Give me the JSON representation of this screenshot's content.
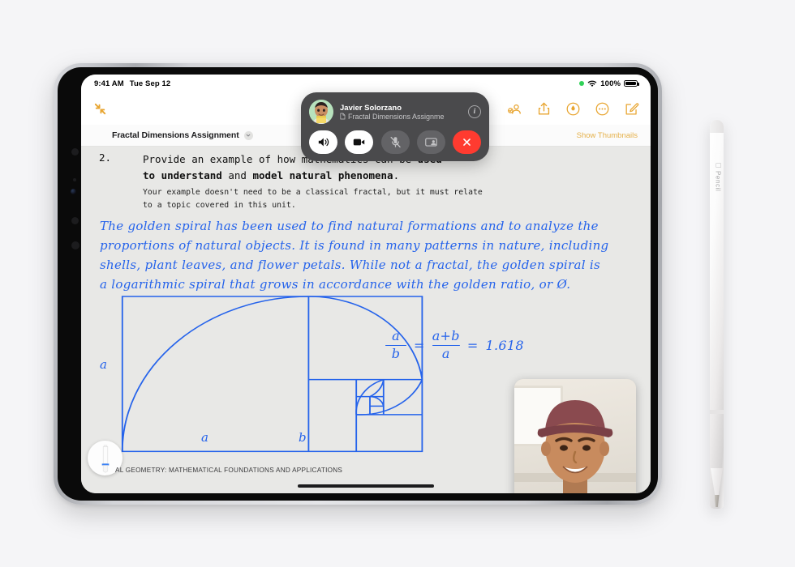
{
  "status_bar": {
    "time": "9:41 AM",
    "date": "Tue Sep 12",
    "battery_percent": "100%",
    "icons": [
      "green-recording-dot",
      "wifi-icon",
      "battery-icon"
    ]
  },
  "toolbar": {
    "collapse_icon": "collapse-arrows-icon",
    "right_icons": [
      {
        "name": "collaborate-icon",
        "label": "Collaborate"
      },
      {
        "name": "share-icon",
        "label": "Share"
      },
      {
        "name": "markup-icon",
        "label": "Markup"
      },
      {
        "name": "more-icon",
        "label": "More"
      },
      {
        "name": "compose-icon",
        "label": "Compose"
      }
    ],
    "accent_color": "#e8a530"
  },
  "document_bar": {
    "title": "Fractal Dimensions Assignment",
    "chevron": "chevron-down-icon",
    "show_thumbnails_label": "Show Thumbnails"
  },
  "facetime": {
    "caller_name": "Javier Solorzano",
    "activity": "Fractal Dimensions Assignme",
    "activity_icon": "document-icon",
    "info_label": "i",
    "avatar": "memoji-avatar",
    "controls": [
      {
        "name": "speaker-button",
        "label": "Speaker",
        "state": "on"
      },
      {
        "name": "video-button",
        "label": "Video",
        "state": "on"
      },
      {
        "name": "mute-button",
        "label": "Mute",
        "state": "muted"
      },
      {
        "name": "shareplay-button",
        "label": "SharePlay",
        "state": "off"
      },
      {
        "name": "end-call-button",
        "label": "End Call",
        "state": "end"
      }
    ],
    "end_color": "#ff3b30"
  },
  "document": {
    "question_number": "2.",
    "question_line1_plain_a": "Provide an example of how mathematics can be ",
    "question_line1_bold": "used",
    "question_line2_bold_a": "to understand",
    "question_line2_plain": " and ",
    "question_line2_bold_b": "model natural phenomena",
    "question_line2_end": ".",
    "subtext_line1": "Your example doesn't need to be a classical fractal, but it must relate",
    "subtext_line2": "to a topic covered in this unit.",
    "handwriting": [
      "The golden spiral has been used to find natural formations and to analyze the",
      "proportions of natural objects. It is found in many patterns in nature, including",
      "shells, plant leaves, and flower petals. While not a fractal, the golden spiral is",
      "a logarithmic spiral that grows in accordance with the golden ratio, or Ø."
    ],
    "handwriting_color": "#2563eb",
    "diagram": {
      "name": "golden-spiral-diagram",
      "label_a_left": "a",
      "label_a_bottom": "a",
      "label_b_bottom": "b"
    },
    "equation": {
      "frac1_num": "a",
      "frac1_den": "b",
      "equals1": "=",
      "frac2_num": "a+b",
      "frac2_den": "a",
      "equals2": "=",
      "result": "1.618"
    },
    "caption": "AL GEOMETRY: MATHEMATICAL FOUNDATIONS AND APPLICATIONS",
    "pen_tool": "pen-tool-icon"
  },
  "video_tile": {
    "name": "self-video-preview",
    "description": "Smiling person wearing a maroon cap and denim jacket"
  },
  "pencil": {
    "brand_glyph": "",
    "label": "Pencil"
  }
}
